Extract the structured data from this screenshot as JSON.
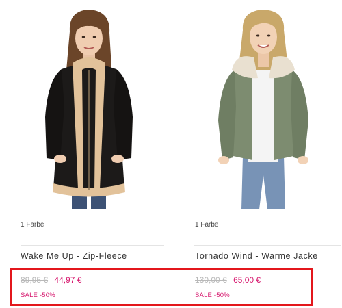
{
  "products": [
    {
      "colors_label": "1 Farbe",
      "name": "Wake Me Up - Zip-Fleece",
      "old_price": "89,95 €",
      "new_price": "44,97 €",
      "sale": "SALE -50%",
      "image_desc": "woman in black faux-fur zip fleece with beige trim"
    },
    {
      "colors_label": "1 Farbe",
      "name": "Tornado Wind - Warme Jacke",
      "old_price": "130,00 €",
      "new_price": "65,00 €",
      "sale": "SALE -50%",
      "image_desc": "woman in olive green jacket with sherpa collar"
    }
  ],
  "colors": {
    "sale_pink": "#d6176d",
    "highlight_red": "#e3171c",
    "old_price_grey": "#b9b9b9"
  }
}
